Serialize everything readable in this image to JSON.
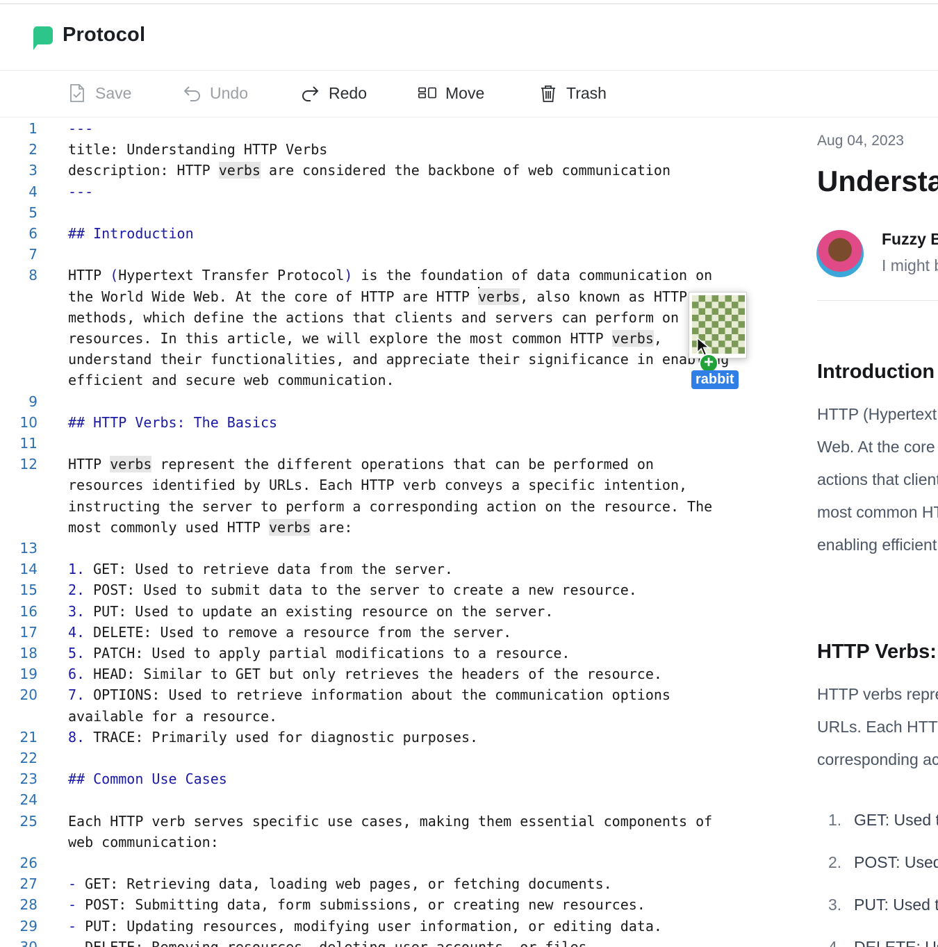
{
  "app": {
    "title": "Protocol"
  },
  "toolbar": {
    "save": "Save",
    "undo": "Undo",
    "redo": "Redo",
    "move": "Move",
    "trash": "Trash"
  },
  "editor": {
    "lines": [
      {
        "n": "1",
        "segs": [
          {
            "t": "---",
            "c": "md"
          }
        ]
      },
      {
        "n": "2",
        "segs": [
          {
            "t": "title: Understanding HTTP Verbs"
          }
        ]
      },
      {
        "n": "3",
        "segs": [
          {
            "t": "description: HTTP "
          },
          {
            "t": "verbs",
            "c": "hl"
          },
          {
            "t": " are considered the backbone of web communication"
          }
        ]
      },
      {
        "n": "4",
        "segs": [
          {
            "t": "---",
            "c": "md"
          }
        ]
      },
      {
        "n": "5",
        "segs": []
      },
      {
        "n": "6",
        "segs": [
          {
            "t": "## Introduction",
            "c": "md"
          }
        ]
      },
      {
        "n": "7",
        "segs": []
      },
      {
        "n": "8",
        "segs": [
          {
            "t": "HTTP "
          },
          {
            "t": "(",
            "c": "md"
          },
          {
            "t": "Hypertext Transfer Protocol"
          },
          {
            "t": ")",
            "c": "md"
          },
          {
            "t": " is the foundation of data communication on"
          }
        ]
      },
      {
        "n": "",
        "segs": [
          {
            "t": "the World Wide Web. At the core of HTTP are HTTP "
          },
          {
            "t": "",
            "c": "cursor"
          },
          {
            "t": "verbs",
            "c": "hl"
          },
          {
            "t": ", also known as HTTP"
          }
        ]
      },
      {
        "n": "",
        "segs": [
          {
            "t": "methods, which define the actions that clients and servers can perform on"
          }
        ]
      },
      {
        "n": "",
        "segs": [
          {
            "t": "resources. In this article, we will explore the most common HTTP "
          },
          {
            "t": "verbs",
            "c": "hl"
          },
          {
            "t": ","
          }
        ]
      },
      {
        "n": "",
        "segs": [
          {
            "t": "understand their functionalities, and appreciate their significance in enabling"
          }
        ]
      },
      {
        "n": "",
        "segs": [
          {
            "t": "efficient and secure web communication."
          }
        ]
      },
      {
        "n": "9",
        "segs": []
      },
      {
        "n": "10",
        "segs": [
          {
            "t": "## HTTP Verbs: The Basics",
            "c": "md"
          }
        ]
      },
      {
        "n": "11",
        "segs": []
      },
      {
        "n": "12",
        "segs": [
          {
            "t": "HTTP "
          },
          {
            "t": "verbs",
            "c": "hl"
          },
          {
            "t": " represent the different operations that can be performed on"
          }
        ]
      },
      {
        "n": "",
        "segs": [
          {
            "t": "resources identified by URLs. Each HTTP verb conveys a specific intention,"
          }
        ]
      },
      {
        "n": "",
        "segs": [
          {
            "t": "instructing the server to perform a corresponding action on the resource. The"
          }
        ]
      },
      {
        "n": "",
        "segs": [
          {
            "t": "most commonly used HTTP "
          },
          {
            "t": "verbs",
            "c": "hl"
          },
          {
            "t": " are:"
          }
        ]
      },
      {
        "n": "13",
        "segs": []
      },
      {
        "n": "14",
        "segs": [
          {
            "t": "1.",
            "c": "md"
          },
          {
            "t": " GET: Used to retrieve data from the server."
          }
        ]
      },
      {
        "n": "15",
        "segs": [
          {
            "t": "2.",
            "c": "md"
          },
          {
            "t": " POST: Used to submit data to the server to create a new resource."
          }
        ]
      },
      {
        "n": "16",
        "segs": [
          {
            "t": "3.",
            "c": "md"
          },
          {
            "t": " PUT: Used to update an existing resource on the server."
          }
        ]
      },
      {
        "n": "17",
        "segs": [
          {
            "t": "4.",
            "c": "md"
          },
          {
            "t": " DELETE: Used to remove a resource from the server."
          }
        ]
      },
      {
        "n": "18",
        "segs": [
          {
            "t": "5.",
            "c": "md"
          },
          {
            "t": " PATCH: Used to apply partial modifications to a resource."
          }
        ]
      },
      {
        "n": "19",
        "segs": [
          {
            "t": "6.",
            "c": "md"
          },
          {
            "t": " HEAD: Similar to GET but only retrieves the headers of the resource."
          }
        ]
      },
      {
        "n": "20",
        "segs": [
          {
            "t": "7.",
            "c": "md"
          },
          {
            "t": " OPTIONS: Used to retrieve information about the communication options"
          }
        ]
      },
      {
        "n": "",
        "segs": [
          {
            "t": "available for a resource."
          }
        ]
      },
      {
        "n": "21",
        "segs": [
          {
            "t": "8.",
            "c": "md"
          },
          {
            "t": " TRACE: Primarily used for diagnostic purposes."
          }
        ]
      },
      {
        "n": "22",
        "segs": []
      },
      {
        "n": "23",
        "segs": [
          {
            "t": "## Common Use Cases",
            "c": "md"
          }
        ]
      },
      {
        "n": "24",
        "segs": []
      },
      {
        "n": "25",
        "segs": [
          {
            "t": "Each HTTP verb serves specific use cases, making them essential components of"
          }
        ]
      },
      {
        "n": "",
        "segs": [
          {
            "t": "web communication:"
          }
        ]
      },
      {
        "n": "26",
        "segs": []
      },
      {
        "n": "27",
        "segs": [
          {
            "t": "-",
            "c": "md"
          },
          {
            "t": " GET: Retrieving data, loading web pages, or fetching documents."
          }
        ]
      },
      {
        "n": "28",
        "segs": [
          {
            "t": "-",
            "c": "md"
          },
          {
            "t": " POST: Submitting data, form submissions, or creating new resources."
          }
        ]
      },
      {
        "n": "29",
        "segs": [
          {
            "t": "-",
            "c": "md"
          },
          {
            "t": " PUT: Updating resources, modifying user information, or editing data."
          }
        ]
      },
      {
        "n": "30",
        "segs": [
          {
            "t": "-",
            "c": "md"
          },
          {
            "t": " DELETE: Removing resources, deleting user accounts, or files."
          }
        ]
      }
    ]
  },
  "drag": {
    "label": "rabbit",
    "badge": "+"
  },
  "preview": {
    "date": "Aug 04, 2023",
    "title": "Understanding HTTP Verbs",
    "author": "Fuzzy Bear",
    "bio": "I might be a bear",
    "sections": [
      {
        "heading": "Introduction",
        "paragraph": [
          "HTTP (Hypertext Transfer Protocol) is the foundation of data communication on the World Wide",
          "Web. At the core of HTTP are HTTP verbs, also known as HTTP methods, which define the",
          "actions that clients and servers can perform on resources. In this article, we will explore the",
          "most common HTTP verbs, understand their functionalities, and appreciate their significance in",
          "enabling efficient and secure web communication."
        ]
      },
      {
        "heading": "HTTP Verbs: The Basics",
        "paragraph": [
          "HTTP verbs represent the different operations that can be performed on resources identified by",
          "URLs. Each HTTP verb conveys a specific intention, instructing the server to perform a",
          "corresponding action on the resource. The most commonly used HTTP verbs are:"
        ]
      }
    ],
    "list": [
      {
        "num": "1.",
        "text": "GET: Used to retrieve data from the server."
      },
      {
        "num": "2.",
        "text": "POST: Used to submit data to the server to create a new resource."
      },
      {
        "num": "3.",
        "text": "PUT: Used to update an existing resource on the server."
      },
      {
        "num": "4.",
        "text": "DELETE: Used to remove a resource from the server."
      }
    ]
  },
  "colors": {
    "accent": "#2ec58a",
    "markdown": "#1a1aa6",
    "line_numbers": "#2a6fb5",
    "highlight": "#e6e6e6",
    "drag_tag": "#2f7fe6",
    "plus_badge": "#22a33a"
  },
  "icons": {
    "logo": "chat-bubble-logo",
    "save": "file-check-icon",
    "undo": "undo-arrow-icon",
    "redo": "redo-arrow-icon",
    "move": "move-icon",
    "trash": "trash-icon"
  }
}
